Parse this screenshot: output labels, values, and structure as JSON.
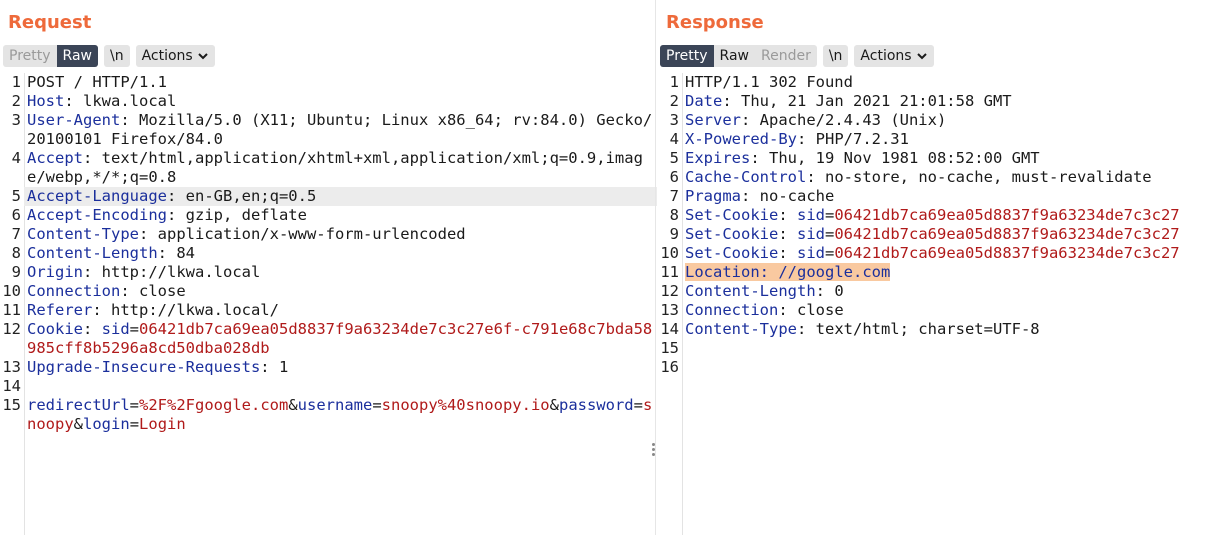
{
  "request": {
    "title": "Request",
    "tabs": [
      "Pretty",
      "Raw"
    ],
    "active_tab": "Raw",
    "newline_label": "\\n",
    "actions_label": "Actions",
    "lines": [
      {
        "n": "1",
        "k": "",
        "v": "POST / HTTP/1.1"
      },
      {
        "n": "2",
        "k": "Host",
        "v": "lkwa.local"
      },
      {
        "n": "3",
        "k": "User-Agent",
        "v": "Mozilla/5.0 (X11; Ubuntu; Linux x86_64; rv:84.0) Gecko/20100101 Firefox/84.0"
      },
      {
        "n": "4",
        "k": "Accept",
        "v": "text/html,application/xhtml+xml,application/xml;q=0.9,image/webp,*/*;q=0.8"
      },
      {
        "n": "5",
        "k": "Accept-Language",
        "v": "en-GB,en;q=0.5"
      },
      {
        "n": "6",
        "k": "Accept-Encoding",
        "v": "gzip, deflate"
      },
      {
        "n": "7",
        "k": "Content-Type",
        "v": "application/x-www-form-urlencoded"
      },
      {
        "n": "8",
        "k": "Content-Length",
        "v": "84"
      },
      {
        "n": "9",
        "k": "Origin",
        "v": "http://lkwa.local"
      },
      {
        "n": "10",
        "k": "Connection",
        "v": "close"
      },
      {
        "n": "11",
        "k": "Referer",
        "v": "http://lkwa.local/"
      },
      {
        "n": "12",
        "k": "Cookie",
        "cookie_name": "sid",
        "cookie_value": "06421db7ca69ea05d8837f9a63234de7c3c27e6f-c791e68c7bda58985cff8b5296a8cd50dba028db"
      },
      {
        "n": "13",
        "k": "Upgrade-Insecure-Requests",
        "v": "1"
      },
      {
        "n": "14",
        "k": "",
        "v": ""
      },
      {
        "n": "15",
        "body": [
          {
            "name": "redirectUrl",
            "value": "%2F%2Fgoogle.com"
          },
          {
            "name": "username",
            "value": "snoopy%40snoopy.io"
          },
          {
            "name": "password",
            "value": "snoopy"
          },
          {
            "name": "login",
            "value": "Login"
          }
        ]
      }
    ],
    "highlighted_line": "5"
  },
  "response": {
    "title": "Response",
    "tabs": [
      "Pretty",
      "Raw",
      "Render"
    ],
    "active_tab": "Pretty",
    "newline_label": "\\n",
    "actions_label": "Actions",
    "lines": [
      {
        "n": "1",
        "k": "",
        "v": "HTTP/1.1 302 Found"
      },
      {
        "n": "2",
        "k": "Date",
        "v": "Thu, 21 Jan 2021 21:01:58 GMT"
      },
      {
        "n": "3",
        "k": "Server",
        "v": "Apache/2.4.43 (Unix)"
      },
      {
        "n": "4",
        "k": "X-Powered-By",
        "v": "PHP/7.2.31"
      },
      {
        "n": "5",
        "k": "Expires",
        "v": "Thu, 19 Nov 1981 08:52:00 GMT"
      },
      {
        "n": "6",
        "k": "Cache-Control",
        "v": "no-store, no-cache, must-revalidate"
      },
      {
        "n": "7",
        "k": "Pragma",
        "v": "no-cache"
      },
      {
        "n": "8",
        "k": "Set-Cookie",
        "cookie_name": "sid",
        "cookie_value": "06421db7ca69ea05d8837f9a63234de7c3c27"
      },
      {
        "n": "9",
        "k": "Set-Cookie",
        "cookie_name": "sid",
        "cookie_value": "06421db7ca69ea05d8837f9a63234de7c3c27"
      },
      {
        "n": "10",
        "k": "Set-Cookie",
        "cookie_name": "sid",
        "cookie_value": "06421db7ca69ea05d8837f9a63234de7c3c27"
      },
      {
        "n": "11",
        "k": "Location",
        "v": "//google.com",
        "highlight": true
      },
      {
        "n": "12",
        "k": "Content-Length",
        "v": "0"
      },
      {
        "n": "13",
        "k": "Connection",
        "v": "close"
      },
      {
        "n": "14",
        "k": "Content-Type",
        "v": "text/html; charset=UTF-8"
      },
      {
        "n": "15",
        "k": "",
        "v": ""
      },
      {
        "n": "16",
        "k": "",
        "v": ""
      }
    ]
  },
  "colors": {
    "title_orange": "#ee6a3b",
    "active_tab_bg": "#3b4557",
    "header_key_blue": "#1b2f9c",
    "param_value_red": "#b01a1a",
    "location_highlight": "#f9c9a0",
    "line_highlight": "#ececec"
  },
  "icons": {
    "actions_dropdown": "chevron-down-icon",
    "editor_menu": "kebab-menu-icon"
  }
}
